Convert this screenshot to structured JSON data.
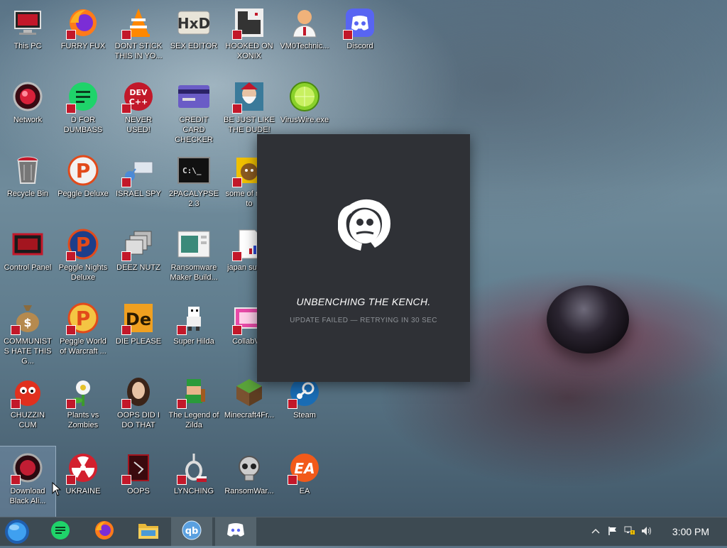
{
  "desktop": {
    "icons": [
      {
        "label": "This PC",
        "icon": "monitor-icon"
      },
      {
        "label": "FURRY FUX",
        "icon": "firefox-icon"
      },
      {
        "label": "DONT STICK THIS IN YO...",
        "icon": "vlc-cone-icon"
      },
      {
        "label": "SEX EDITOR",
        "icon": "hxd-icon"
      },
      {
        "label": "HOOKED ON XONIX",
        "icon": "xonix-icon"
      },
      {
        "label": "VM0Technic...",
        "icon": "doctor-icon"
      },
      {
        "label": "Discord",
        "icon": "discord-icon"
      },
      {
        "label": "Network",
        "icon": "network-orb-icon"
      },
      {
        "label": "D FOR DUMBASS",
        "icon": "note-icon"
      },
      {
        "label": "NEVER USED!",
        "icon": "devcpp-icon"
      },
      {
        "label": "CREDIT CARD CHECKER",
        "icon": "credit-card-icon"
      },
      {
        "label": "BE JUST LIKE THE DUDE!",
        "icon": "dude-icon"
      },
      {
        "label": "VirusWire.exe",
        "icon": "lime-icon"
      },
      {
        "label": "Recycle Bin",
        "icon": "recycle-bin-icon"
      },
      {
        "label": "Peggle Deluxe",
        "icon": "peggle-icon"
      },
      {
        "label": "ISRAEL SPY",
        "icon": "network-card-icon"
      },
      {
        "label": "2PACALYPSE 2.3",
        "icon": "terminal-icon"
      },
      {
        "label": "some of need to",
        "icon": "dog-icon"
      },
      {
        "label": "Control Panel",
        "icon": "control-panel-icon"
      },
      {
        "label": "Peggle Nights Deluxe",
        "icon": "peggle-nights-icon"
      },
      {
        "label": "DEEZ NUTZ",
        "icon": "windows-stack-icon"
      },
      {
        "label": "Ransomware Maker Build...",
        "icon": "builder-window-icon"
      },
      {
        "label": "japan su sim",
        "icon": "file-icon"
      },
      {
        "label": "COMMUNISTS HATE THIS G...",
        "icon": "money-bag-icon"
      },
      {
        "label": "Peggle World of Warcraft ...",
        "icon": "peggle-wow-icon"
      },
      {
        "label": "DIE PLEASE",
        "icon": "de-icon"
      },
      {
        "label": "Super Hilda",
        "icon": "pixel-character-icon"
      },
      {
        "label": "CollabVM",
        "icon": "collabvm-icon"
      },
      {
        "label": "CHUZZIN CUM",
        "icon": "chuzzle-icon"
      },
      {
        "label": "Plants vs Zombies",
        "icon": "pvz-icon"
      },
      {
        "label": "OOPS DID I DO THAT",
        "icon": "portrait-icon"
      },
      {
        "label": "The Legend of Zilda",
        "icon": "zelda-icon"
      },
      {
        "label": "Minecraft4Fr...",
        "icon": "minecraft-icon"
      },
      {
        "label": "Steam",
        "icon": "steam-icon"
      },
      {
        "label": "Download Black Ali...",
        "icon": "download-orb-icon"
      },
      {
        "label": "UKRAINE",
        "icon": "radiation-icon"
      },
      {
        "label": "OOPS",
        "icon": "book-icon"
      },
      {
        "label": "LYNCHING",
        "icon": "noose-icon"
      },
      {
        "label": "RansomWar...",
        "icon": "skull-icon"
      },
      {
        "label": "EA",
        "icon": "ea-icon"
      }
    ]
  },
  "dialog": {
    "title": "UNBENCHING THE KENCH.",
    "status": "UPDATE FAILED — RETRYING IN 30 SEC",
    "bg": "#2f3136"
  },
  "taskbar": {
    "apps": [
      {
        "name": "notes",
        "icon": "note-icon"
      },
      {
        "name": "firefox",
        "icon": "firefox-icon"
      },
      {
        "name": "explorer",
        "icon": "folder-icon"
      },
      {
        "name": "qbittorrent",
        "icon": "qbittorrent-icon"
      },
      {
        "name": "discord",
        "icon": "discord-icon"
      }
    ],
    "clock": "3:00 PM"
  },
  "colors": {
    "discord_blurple": "#5865f2",
    "badge_red": "#c2182a",
    "taskbar": "#3d4a52"
  }
}
